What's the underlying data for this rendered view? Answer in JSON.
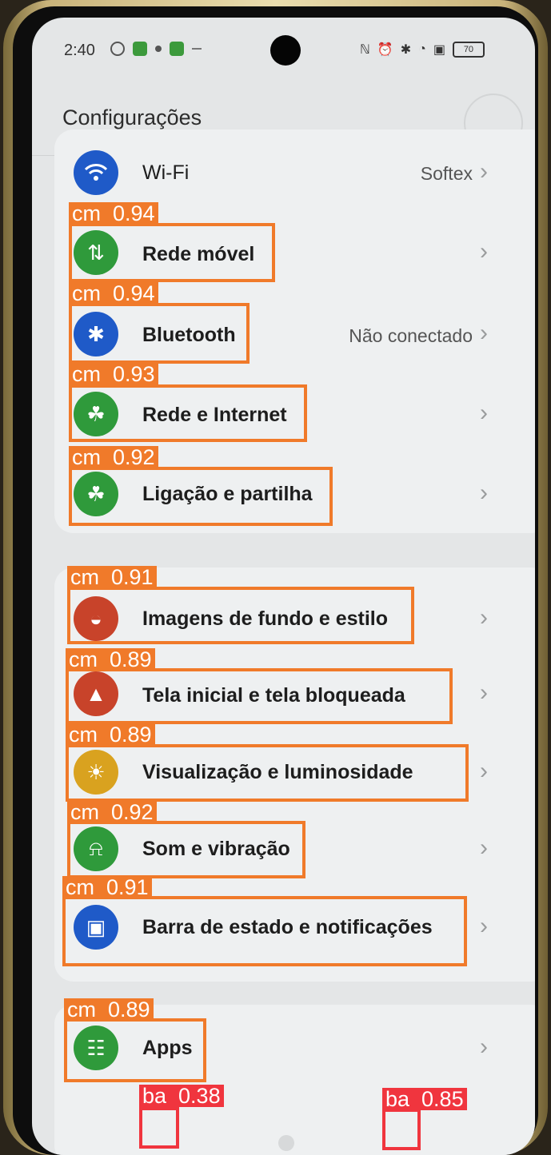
{
  "status_bar": {
    "time": "2:40",
    "battery": "70"
  },
  "header": {
    "title": "Configurações"
  },
  "group1": [
    {
      "label": "Wi-Fi",
      "value": "Softex",
      "icon": "wifi-icon",
      "color": "#1f5ac8"
    },
    {
      "label": "Rede móvel",
      "value": "",
      "icon": "mobile-data-icon",
      "color": "#2f9a3b"
    },
    {
      "label": "Bluetooth",
      "value": "Não conectado",
      "icon": "bluetooth-icon",
      "color": "#1f5ac8"
    },
    {
      "label": "Rede e Internet",
      "value": "",
      "icon": "network-icon",
      "color": "#2f9a3b"
    },
    {
      "label": "Ligação e partilha",
      "value": "",
      "icon": "share-icon",
      "color": "#2f9a3b"
    }
  ],
  "group2": [
    {
      "label": "Imagens de fundo e estilo",
      "icon": "palette-icon",
      "color": "#c8432a"
    },
    {
      "label": "Tela inicial e tela bloqueada",
      "icon": "image-icon",
      "color": "#c8432a"
    },
    {
      "label": "Visualização e luminosidade",
      "icon": "sun-icon",
      "color": "#d9a21f"
    },
    {
      "label": "Som e vibração",
      "icon": "bell-icon",
      "color": "#2f9a3b"
    },
    {
      "label": "Barra de estado e notificações",
      "icon": "notification-icon",
      "color": "#1f5ac8"
    }
  ],
  "group3": [
    {
      "label": "Apps",
      "icon": "apps-grid-icon",
      "color": "#2f9a3b"
    }
  ],
  "detections": [
    {
      "tag": "cm  0.94"
    },
    {
      "tag": "cm  0.94"
    },
    {
      "tag": "cm  0.93"
    },
    {
      "tag": "cm  0.92"
    },
    {
      "tag": "cm  0.91"
    },
    {
      "tag": "cm  0.89"
    },
    {
      "tag": "cm  0.89"
    },
    {
      "tag": "cm  0.92"
    },
    {
      "tag": "cm  0.91"
    },
    {
      "tag": "cm  0.89"
    },
    {
      "tag": "ba  0.38"
    },
    {
      "tag": "ba  0.85"
    }
  ]
}
